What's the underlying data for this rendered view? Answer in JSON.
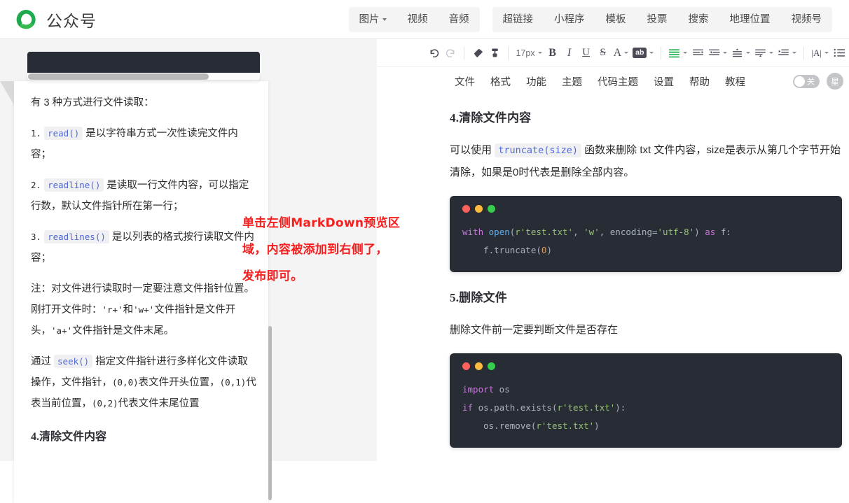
{
  "header": {
    "brand": "公众号",
    "logo_icon": "wechat-mp-logo",
    "media_group": [
      {
        "label": "图片",
        "has_caret": true
      },
      {
        "label": "视频",
        "has_caret": false
      },
      {
        "label": "音频",
        "has_caret": false
      }
    ],
    "insert_group": [
      {
        "label": "超链接"
      },
      {
        "label": "小程序"
      },
      {
        "label": "模板"
      },
      {
        "label": "投票"
      },
      {
        "label": "搜索"
      },
      {
        "label": "地理位置"
      },
      {
        "label": "视频号"
      }
    ]
  },
  "toolbar": {
    "undo_icon": "undo-icon",
    "redo_icon": "redo-icon",
    "eraser_icon": "eraser-icon",
    "format-brush_icon": "format-brush-icon",
    "font_size": "17px",
    "bold": "B",
    "italic": "I",
    "underline": "U",
    "strikethrough": "S",
    "font_color": "A",
    "highlight": "ab",
    "align_justify_icon": "align-justify-icon",
    "indent_increase_icon": "indent-increase-icon",
    "indent_decrease_icon": "indent-decrease-icon",
    "line_height_icon": "line-height-icon",
    "paragraph_spacing_icon": "paragraph-spacing-icon",
    "text_indent_icon": "text-indent-icon",
    "letter_spacing_icon": "letter-spacing-icon",
    "list_icon": "list-icon"
  },
  "menurow2": {
    "items": [
      {
        "label": "文件"
      },
      {
        "label": "格式"
      },
      {
        "label": "功能"
      },
      {
        "label": "主题"
      },
      {
        "label": "代码主题"
      },
      {
        "label": "设置"
      },
      {
        "label": "帮助"
      },
      {
        "label": "教程"
      }
    ],
    "toggle_label": "关",
    "avatar_label": "星"
  },
  "annotation": {
    "lines": [
      "单击左侧MarkDown预览区",
      "域，内容被添加到右侧了，",
      "发布即可。"
    ],
    "color": "#f41f1f"
  },
  "left_preview": {
    "intro": "有 3 种方式进行文件读取：",
    "items": [
      {
        "num": "1.",
        "code": "read()",
        "text": "是以字符串方式一次性读完文件内容；"
      },
      {
        "num": "2.",
        "code": "readline()",
        "text": "是读取一行文件内容，可以指定行数，默认文件指针所在第一行；"
      },
      {
        "num": "3.",
        "code": "readlines()",
        "text": "是以列表的格式按行读取文件内容；"
      }
    ],
    "note_a": "注：对文件进行读取时一定要注意文件指针位置。刚打开文件时：",
    "note_b": "'r+'",
    "note_c": "和",
    "note_d": "'w+'",
    "note_e": "文件指针是文件开头，",
    "note_f": "'a+'",
    "note_g": "文件指针是文件末尾。",
    "seek_a": "通过",
    "seek_code": "seek()",
    "seek_b": "指定文件指针进行多样化文件读取操作，文件指针，",
    "seek_c": "(0,0)",
    "seek_d": "表文件开头位置，",
    "seek_e": "(0,1)",
    "seek_f": "代表当前位置，",
    "seek_g": "(0,2)",
    "seek_h": "代表文件末尾位置",
    "heading": "4.清除文件内容"
  },
  "article": {
    "heading_1": "4.清除文件内容",
    "para_1_a": "可以使用",
    "para_1_code": "truncate(size)",
    "para_1_b": "函数来删除 txt 文件内容，size是表示从第几个字节开始清除，如果是0时代表是删除全部内容。",
    "code_1": {
      "window_dots": [
        "red",
        "yellow",
        "green"
      ],
      "lines": [
        "with open(r'test.txt', 'w', encoding='utf-8') as f:",
        "    f.truncate(0)"
      ]
    },
    "heading_2": "5.删除文件",
    "para_2": "删除文件前一定要判断文件是否存在",
    "code_2": {
      "window_dots": [
        "red",
        "yellow",
        "green"
      ],
      "lines": [
        "import os",
        "if os.path.exists(r'test.txt'):",
        "    os.remove(r'test.txt')"
      ]
    }
  },
  "colors": {
    "brand_green": "#2ba245",
    "code_bg": "#282c34",
    "accent_red": "#f41f1f",
    "inline_code": "#4e69d6"
  }
}
